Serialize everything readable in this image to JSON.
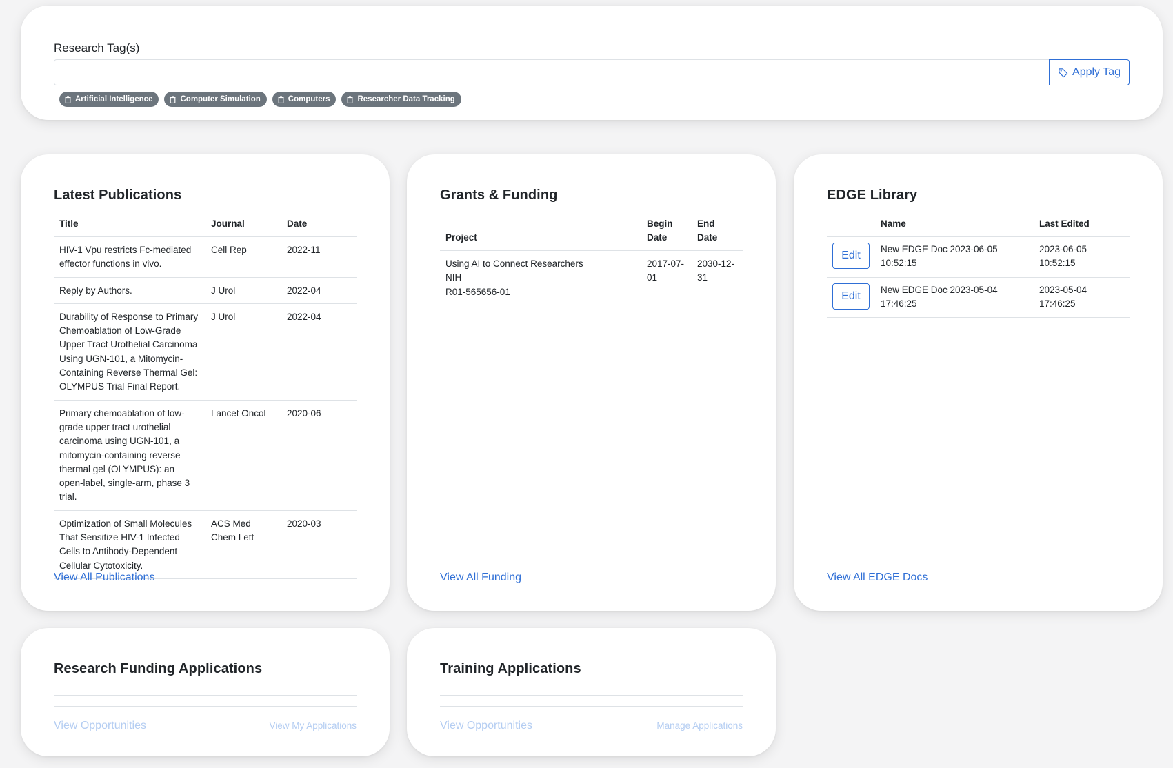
{
  "tags": {
    "label": "Research Tag(s)",
    "input_value": "",
    "apply_label": "Apply Tag",
    "chips": [
      "Artificial Intelligence",
      "Computer Simulation",
      "Computers",
      "Researcher Data Tracking"
    ]
  },
  "publications": {
    "title": "Latest Publications",
    "columns": [
      "Title",
      "Journal",
      "Date"
    ],
    "rows": [
      {
        "title": "HIV-1 Vpu restricts Fc-mediated effector functions in vivo.",
        "journal": "Cell Rep",
        "date": "2022-11"
      },
      {
        "title": "Reply by Authors.",
        "journal": "J Urol",
        "date": "2022-04"
      },
      {
        "title": "Durability of Response to Primary Chemoablation of Low-Grade Upper Tract Urothelial Carcinoma Using UGN-101, a Mitomycin-Containing Reverse Thermal Gel: OLYMPUS Trial Final Report.",
        "journal": "J Urol",
        "date": "2022-04"
      },
      {
        "title": "Primary chemoablation of low-grade upper tract urothelial carcinoma using UGN-101, a mitomycin-containing reverse thermal gel (OLYMPUS): an open-label, single-arm, phase 3 trial.",
        "journal": "Lancet Oncol",
        "date": "2020-06"
      },
      {
        "title": "Optimization of Small Molecules That Sensitize HIV-1 Infected Cells to Antibody-Dependent Cellular Cytotoxicity.",
        "journal": "ACS Med Chem Lett",
        "date": "2020-03"
      }
    ],
    "view_all": "View All Publications"
  },
  "grants": {
    "title": "Grants & Funding",
    "columns": [
      "Project",
      "Begin Date",
      "End Date"
    ],
    "rows": [
      {
        "project": "Using AI to Connect Researchers",
        "agency": "NIH",
        "number": "R01-565656-01",
        "begin": "2017-07-01",
        "end": "2030-12-31"
      }
    ],
    "view_all": "View All Funding"
  },
  "edge": {
    "title": "EDGE Library",
    "columns": [
      "",
      "Name",
      "Last Edited"
    ],
    "edit_label": "Edit",
    "rows": [
      {
        "name": "New EDGE Doc 2023-06-05 10:52:15",
        "last_edited": "2023-06-05 10:52:15"
      },
      {
        "name": "New EDGE Doc 2023-05-04 17:46:25",
        "last_edited": "2023-05-04 17:46:25"
      }
    ],
    "view_all": "View All EDGE Docs"
  },
  "research_funding_apps": {
    "title": "Research Funding Applications",
    "view_opportunities": "View Opportunities",
    "view_my_apps": "View My Applications"
  },
  "training_apps": {
    "title": "Training Applications",
    "view_opportunities": "View Opportunities",
    "manage_apps": "Manage Applications"
  }
}
